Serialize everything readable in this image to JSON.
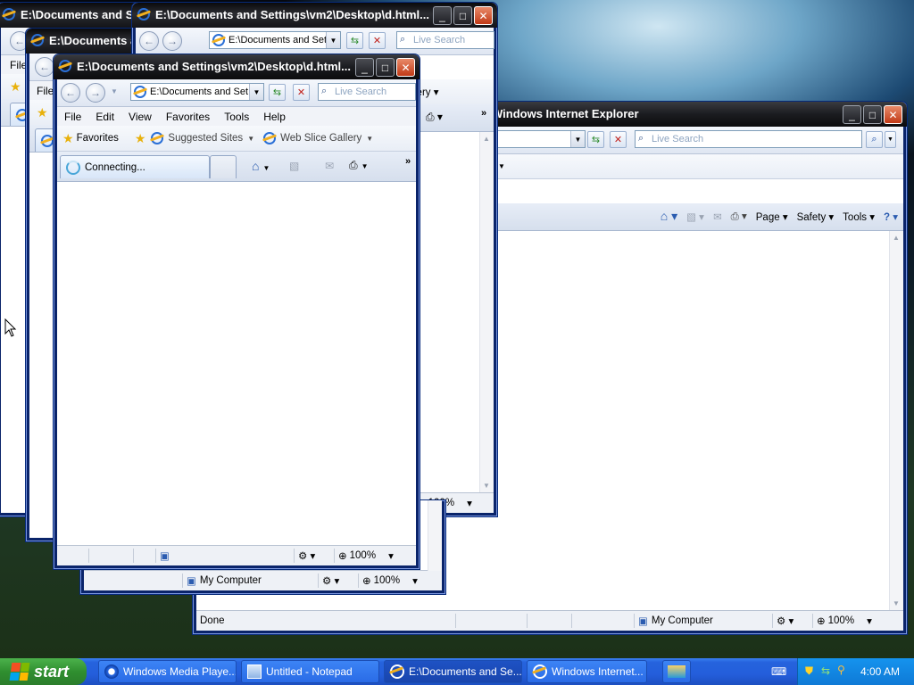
{
  "desktop": {
    "windows": {
      "back1": {
        "title": "E:\\Documents and S",
        "menu_file": "File"
      },
      "back2": {
        "title": "E:\\Documents a",
        "menu_file": "File"
      },
      "win3": {
        "title": "E:\\Documents and Settings\\vm2\\Desktop\\d.html...",
        "address": "E:\\Documents and Set",
        "search_placeholder": "Live Search",
        "favbar_partial": "lery",
        "zoom": "100%",
        "status_location": "My Computer"
      },
      "front": {
        "title": "E:\\Documents and Settings\\vm2\\Desktop\\d.html...",
        "address": "E:\\Documents and Set",
        "search_placeholder": "Live Search",
        "menus": [
          "File",
          "Edit",
          "View",
          "Favorites",
          "Tools",
          "Help"
        ],
        "favorites": {
          "favorites": "Favorites",
          "suggested": "Suggested Sites",
          "webslice": "Web Slice Gallery"
        },
        "tab_label": "Connecting...",
        "zoom": "100%"
      },
      "right": {
        "title": "Windows Internet Explorer",
        "search_placeholder": "Live Search",
        "commands": {
          "page": "Page",
          "safety": "Safety",
          "tools": "Tools"
        },
        "status_text": "Done",
        "status_location": "My Computer",
        "zoom": "100%"
      }
    }
  },
  "taskbar": {
    "start_label": "start",
    "tasks": [
      {
        "label": "Windows Media Playe...",
        "icon": "media-player-icon"
      },
      {
        "label": "Untitled - Notepad",
        "icon": "notepad-icon"
      },
      {
        "label": "E:\\Documents and Se...",
        "icon": "ie-icon"
      },
      {
        "label": "Windows Internet...",
        "icon": "ie-icon"
      }
    ],
    "clock": "4:00 AM"
  },
  "colors": {
    "taskbar": "#245edb",
    "start": "#2f8f2f",
    "tray": "#0f7ad6"
  }
}
